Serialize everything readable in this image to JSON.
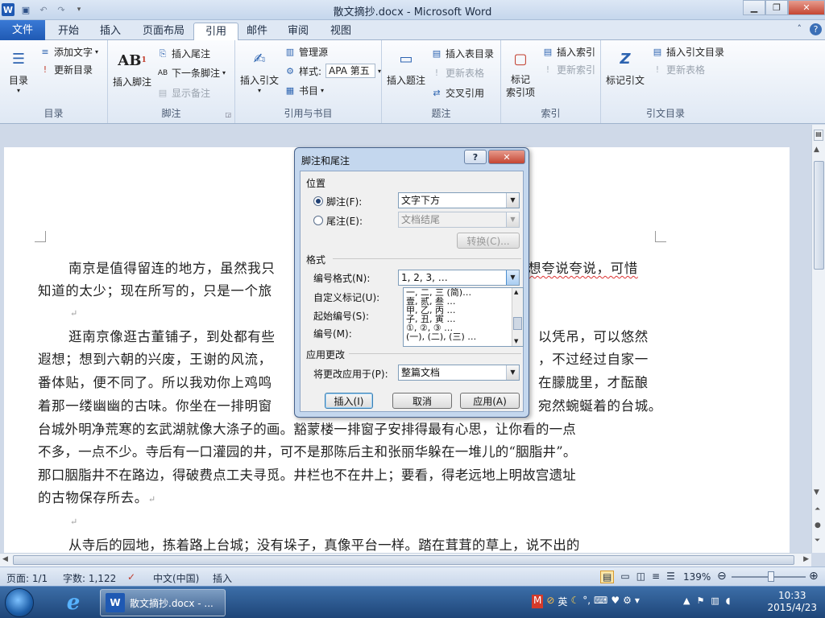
{
  "window": {
    "title": "散文摘抄.docx - Microsoft Word"
  },
  "qat": {
    "app_icon": "W",
    "save": "save-icon",
    "undo": "undo-icon",
    "redo": "redo-icon"
  },
  "tabs": [
    {
      "label": "文件"
    },
    {
      "label": "开始"
    },
    {
      "label": "插入"
    },
    {
      "label": "页面布局"
    },
    {
      "label": "引用"
    },
    {
      "label": "邮件"
    },
    {
      "label": "审阅"
    },
    {
      "label": "视图"
    }
  ],
  "ribbon": {
    "toc": {
      "big": "目录",
      "add_text": "添加文字",
      "update": "更新目录",
      "label": "目录"
    },
    "footnote": {
      "insert": "插入脚注",
      "insert_endnote": "插入尾注",
      "next": "下一条脚注",
      "show": "显示备注",
      "label": "脚注",
      "ab": "AB"
    },
    "citation": {
      "insert": "插入引文",
      "manage": "管理源",
      "style_label": "样式:",
      "style_value": "APA 第五",
      "bib": "书目",
      "label": "引用与书目"
    },
    "caption": {
      "insert": "插入题注",
      "insert_table": "插入表目录",
      "update_table": "更新表格",
      "cross": "交叉引用",
      "label": "题注"
    },
    "index": {
      "mark": "标记\n索引项",
      "insert": "插入索引",
      "update": "更新索引",
      "label": "索引"
    },
    "toa": {
      "mark": "标记引文",
      "insert": "插入引文目录",
      "update": "更新表格",
      "label": "引文目录"
    }
  },
  "document": {
    "p1a": "南京是值得留连的地方，虽然我只",
    "p1b": "想夸说夸说，可惜",
    "p1c": "知道的太少；现在所写的，只是一个旅",
    "p2a": "逛南京像逛古董铺子，到处都有些",
    "p2b": "以凭吊，可以悠然",
    "p2c": "遐想；想到六朝的兴废，王谢的风流，",
    "p2d": "，不过经过自家一",
    "p2e": "番体贴，便不同了。所以我劝你上鸡鸣",
    "p2f": "在朦胧里，才酝酿",
    "p2g": "着那一缕幽幽的古味。你坐在一排明窗",
    "p2h": "宛然蜿蜒着的台城。",
    "p2i": "台城外明净荒寒的玄武湖就像大涤子的画。豁蒙楼一排窗子安排得最有心思，让你看的一点",
    "p2j": "不多，一点不少。寺后有一口灌园的井，可不是那陈后主和张丽华躲在一堆儿的“胭脂井”。",
    "p2k": "那口胭脂井不在路边，得破费点工夫寻觅。井栏也不在井上；要看，得老远地上明故宫遗址",
    "p2l": "的古物保存所去。",
    "p3": "从寺后的园地，拣着路上台城；没有垛子，真像平台一样。踏在茸茸的草上，说不出的",
    "para_mark": "↵"
  },
  "dialog": {
    "title": "脚注和尾注",
    "help": "?",
    "close": "✕",
    "sec_position": "位置",
    "footnote_label": "脚注(F):",
    "footnote_value": "文字下方",
    "endnote_label": "尾注(E):",
    "endnote_value": "文档结尾",
    "convert": "转换(C)...",
    "sec_format": "格式",
    "numformat_label": "编号格式(N):",
    "numformat_value": "1, 2, 3, …",
    "custom_label": "自定义标记(U):",
    "start_label": "起始编号(S):",
    "numbering_label": "编号(M):",
    "dropdown_items": [
      "一, 二, 三 (简)…",
      "壹, 贰, 叁 …",
      "甲, 乙, 丙 …",
      "子, 丑, 寅 …",
      "①, ②, ③ …",
      "(一), (二), (三) …"
    ],
    "sec_apply": "应用更改",
    "apply_label": "将更改应用于(P):",
    "apply_value": "整篇文档",
    "insert": "插入(I)",
    "cancel": "取消",
    "apply": "应用(A)"
  },
  "status": {
    "page": "页面: 1/1",
    "words": "字数: 1,122",
    "lang": "中文(中国)",
    "mode": "插入",
    "zoom": "139%"
  },
  "taskbar": {
    "word_item": "散文摘抄.docx - ...",
    "time": "10:33",
    "date": "2015/4/23",
    "ime": "英"
  }
}
